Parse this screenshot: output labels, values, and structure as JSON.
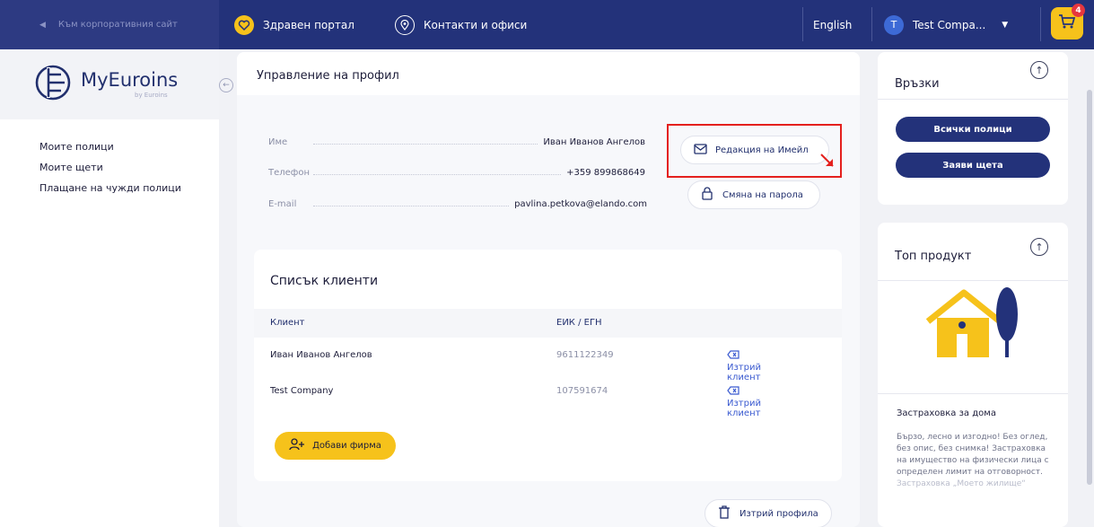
{
  "topbar": {
    "back_label": "Към корпоративния сайт",
    "health_portal": "Здравен портал",
    "contacts": "Контакти и офиси",
    "language": "English",
    "user_initial": "T",
    "user_name": "Test Compa...",
    "cart_count": "4"
  },
  "sidebar": {
    "logo_text": "MyEuroins",
    "logo_sub": "by Euroins",
    "items": [
      {
        "label": "Моите полици"
      },
      {
        "label": "Моите щети"
      },
      {
        "label": "Плащане на чужди полици"
      }
    ]
  },
  "profile": {
    "title": "Управление на профил",
    "name_label": "Име",
    "name_value": "Иван Иванов Ангелов",
    "phone_label": "Телефон",
    "phone_value": "+359 899868649",
    "email_label": "E-mail",
    "email_value": "pavlina.petkova@elando.com",
    "edit_email_label": "Редакция на Имейл",
    "change_password_label": "Смяна на парола"
  },
  "clients": {
    "title": "Списък клиенти",
    "col_client": "Клиент",
    "col_eik": "ЕИК / ЕГН",
    "rows": [
      {
        "name": "Иван Иванов Ангелов",
        "eik": "9611122349",
        "action": "Изтрий клиент"
      },
      {
        "name": "Test Company",
        "eik": "107591674",
        "action": "Изтрий клиент"
      }
    ],
    "add_firm_label": "Добави фирма"
  },
  "delete_profile_label": "Изтрий профила",
  "links": {
    "title": "Връзки",
    "all_policies": "Всички полици",
    "claim": "Заяви щета"
  },
  "top_product": {
    "title": "Топ продукт",
    "product_name": "Застраховка за дома",
    "description": "Бързо, лесно и изгодно! Без оглед, без опис, без снимка! Застраховка на имущество на физически лица с определен лимит на отговорност.",
    "description_fade": "Застраховка „Моето жилище“"
  },
  "colors": {
    "navy": "#23327a",
    "yellow": "#f6c21b",
    "highlight_red": "#e4201d",
    "link_blue": "#3a5ad0"
  }
}
